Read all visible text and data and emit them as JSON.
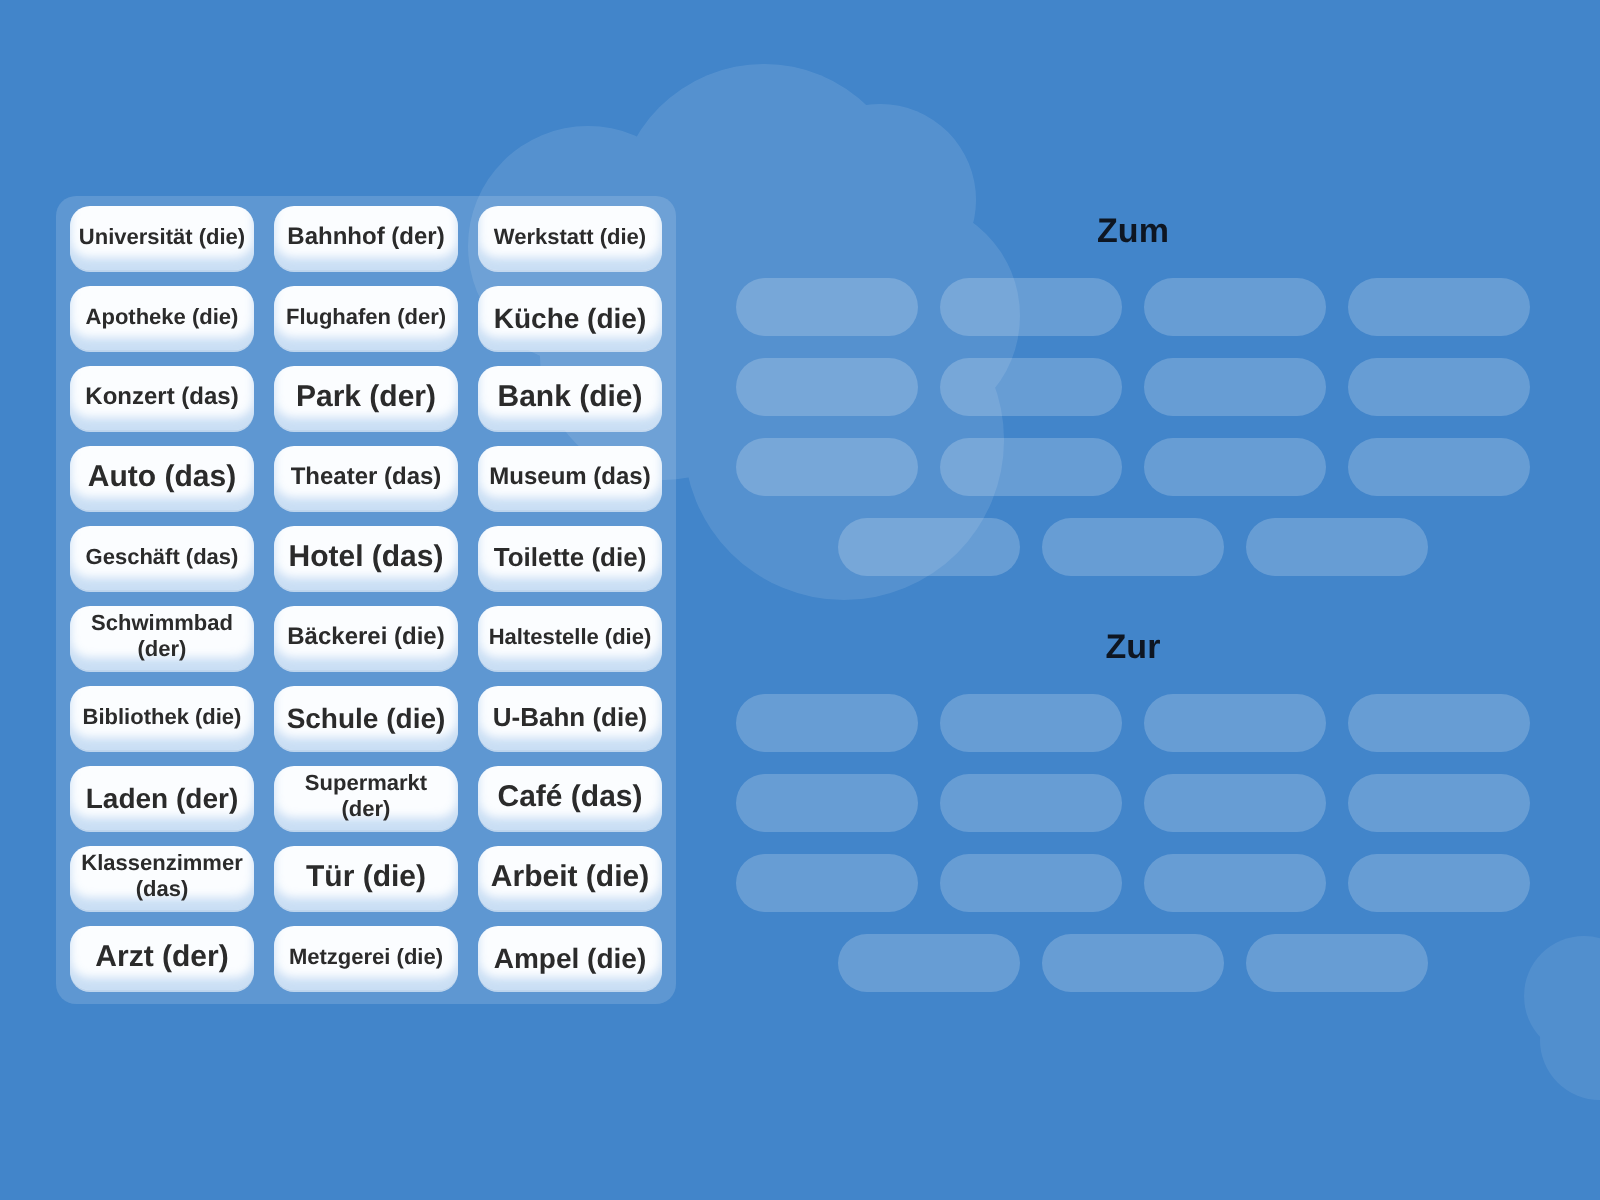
{
  "tiles": [
    "Universität (die)",
    "Bahnhof (der)",
    "Werkstatt (die)",
    "Apotheke (die)",
    "Flughafen (der)",
    "Küche (die)",
    "Konzert (das)",
    "Park (der)",
    "Bank (die)",
    "Auto (das)",
    "Theater (das)",
    "Museum (das)",
    "Geschäft (das)",
    "Hotel (das)",
    "Toilette (die)",
    "Schwimmbad (der)",
    "Bäckerei (die)",
    "Haltestelle (die)",
    "Bibliothek (die)",
    "Schule (die)",
    "U-Bahn (die)",
    "Laden (der)",
    "Supermarkt (der)",
    "Café (das)",
    "Klassenzimmer (das)",
    "Tür (die)",
    "Arbeit (die)",
    "Arzt (der)",
    "Metzgerei (die)",
    "Ampel (die)"
  ],
  "groups": [
    {
      "heading": "Zum"
    },
    {
      "heading": "Zur"
    }
  ]
}
